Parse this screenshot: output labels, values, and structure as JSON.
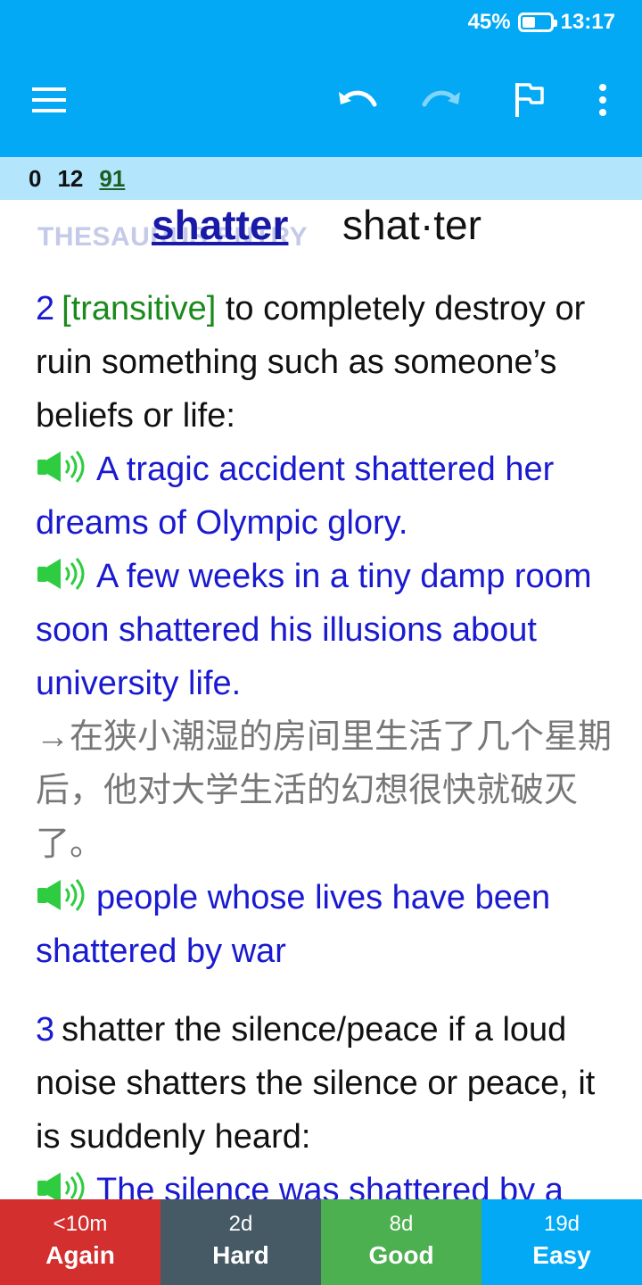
{
  "status_bar": {
    "battery": "45%",
    "time": "13:17",
    "battery_level": 0.45
  },
  "toolbar": {
    "icons": [
      "menu-icon",
      "undo-icon",
      "redo-icon",
      "flag-icon",
      "more-vert-icon"
    ]
  },
  "counts": {
    "new": "0",
    "learning": "12",
    "review": "91"
  },
  "entry": {
    "thesaurus_label": "THESAURUS ENTRY",
    "headword": "shatter",
    "hyphenation": "shat·ter",
    "senses": [
      {
        "number": "2",
        "grammar": "[transitive]",
        "definition": " to completely destroy or ruin something such as someone’s beliefs or life:",
        "examples": [
          {
            "text": "A tragic accident shattered her dreams of Olympic glory.",
            "translation": ""
          },
          {
            "text": "A few weeks in a tiny damp room soon shattered his illusions about university life.",
            "translation": "→在狭小潮湿的房间里生活了几个星期后，他对大学生活的幻想很快就破灭了。"
          },
          {
            "text": "people whose lives have been shattered by war",
            "translation": ""
          }
        ]
      },
      {
        "number": "3",
        "definition": "shatter the silence/peace if a loud noise shatters the silence or peace, it is suddenly heard:",
        "examples": [
          {
            "text": "The silence was shattered by a"
          }
        ]
      }
    ]
  },
  "answer_buttons": [
    {
      "interval": "<10m",
      "label": "Again",
      "color": "#D32F2F"
    },
    {
      "interval": "2d",
      "label": "Hard",
      "color": "#455A64"
    },
    {
      "interval": "8d",
      "label": "Good",
      "color": "#4CAF50"
    },
    {
      "interval": "19d",
      "label": "Easy",
      "color": "#03A9F4"
    }
  ],
  "colors": {
    "appbar": "#03A9F4",
    "counts_bar": "#B3E5FC",
    "example_text": "#1A1AD0",
    "grammar_text": "#1A8A1A"
  }
}
